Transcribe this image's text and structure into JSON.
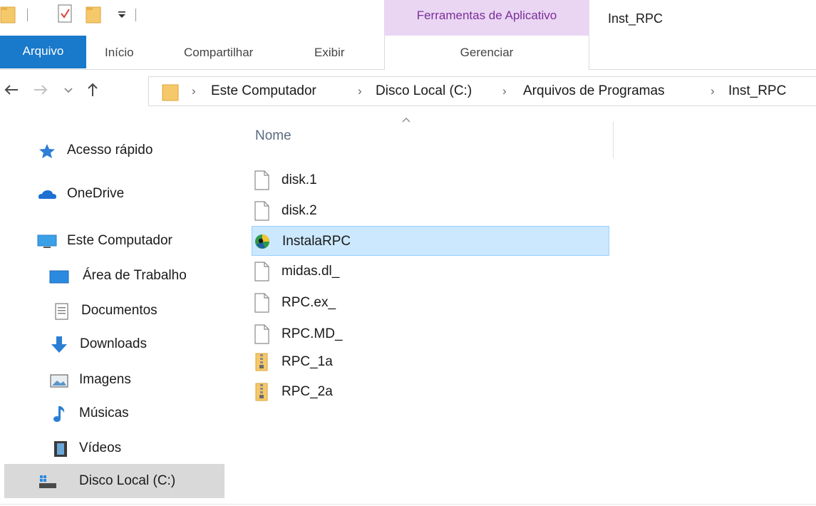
{
  "window": {
    "title": "Inst_RPC",
    "context_tab_group": "Ferramentas de Aplicativo"
  },
  "quick_access": {
    "icons": [
      "folder-icon",
      "properties-icon",
      "new-folder-icon",
      "customize-dropdown-icon"
    ]
  },
  "ribbon": {
    "tabs": [
      {
        "label": "Arquivo"
      },
      {
        "label": "Início"
      },
      {
        "label": "Compartilhar"
      },
      {
        "label": "Exibir"
      },
      {
        "label": "Gerenciar"
      }
    ]
  },
  "address_bar": {
    "crumbs": [
      "Este Computador",
      "Disco Local (C:)",
      "Arquivos de Programas",
      "Inst_RPC"
    ],
    "separator": "›"
  },
  "nav_pane": {
    "items": [
      {
        "label": "Acesso rápido",
        "icon": "star-icon"
      },
      {
        "label": "OneDrive",
        "icon": "cloud-icon"
      },
      {
        "label": "Este Computador",
        "icon": "monitor-icon"
      },
      {
        "label": "Área de Trabalho",
        "icon": "desktop-icon"
      },
      {
        "label": "Documentos",
        "icon": "document-icon"
      },
      {
        "label": "Downloads",
        "icon": "download-arrow-icon"
      },
      {
        "label": "Imagens",
        "icon": "picture-icon"
      },
      {
        "label": "Músicas",
        "icon": "music-note-icon"
      },
      {
        "label": "Vídeos",
        "icon": "film-icon"
      },
      {
        "label": "Disco Local (C:)",
        "icon": "drive-icon",
        "selected": true
      }
    ]
  },
  "file_list": {
    "column_header": "Nome",
    "files": [
      {
        "name": "disk.1",
        "type": "file"
      },
      {
        "name": "disk.2",
        "type": "file"
      },
      {
        "name": "InstalaRPC",
        "type": "app",
        "selected": true
      },
      {
        "name": "midas.dl_",
        "type": "file"
      },
      {
        "name": "RPC.ex_",
        "type": "file"
      },
      {
        "name": "RPC.MD_",
        "type": "file"
      },
      {
        "name": "RPC_1a",
        "type": "zip"
      },
      {
        "name": "RPC_2a",
        "type": "zip"
      }
    ]
  },
  "colors": {
    "accent": "#1979ca",
    "context_tab": "#ead6f3",
    "context_tab_text": "#7a2f99",
    "selection_fill": "#cce8ff",
    "selection_border": "#99d1ff",
    "nav_selected": "#d9d9d9"
  }
}
